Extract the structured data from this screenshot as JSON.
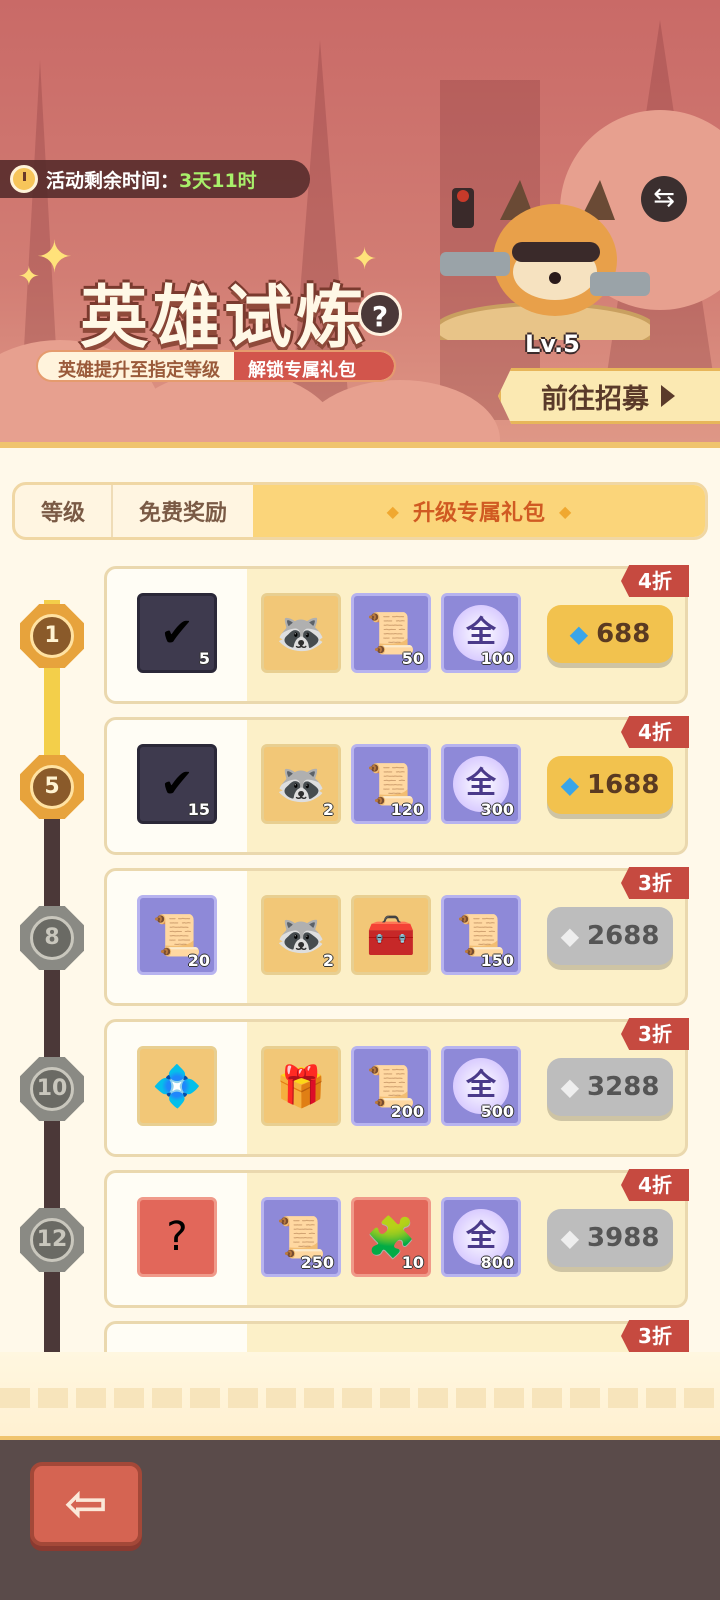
{
  "header": {
    "timer_label": "活动剩余时间：",
    "timer_value": "3天11时",
    "title": "英雄试炼",
    "help_symbol": "?",
    "sub_left": "英雄提升至指定等级",
    "sub_right": "解锁专属礼包",
    "hero_level": "Lv.5",
    "recruit_label": "前往招募"
  },
  "tabs": [
    {
      "label": "等级"
    },
    {
      "label": "免费奖励"
    },
    {
      "label": "升级专属礼包",
      "active": true
    }
  ],
  "rows": [
    {
      "level": "1",
      "unlocked": true,
      "discount": "4折",
      "price": "688",
      "price_style": "gold",
      "items": [
        {
          "icon": "checklist-icon",
          "qty": "5",
          "bg": "dark"
        },
        {
          "icon": "raccoon-hero-icon",
          "qty": "",
          "bg": "orange"
        },
        {
          "icon": "integral-scroll-icon",
          "qty": "50",
          "bg": "purple"
        },
        {
          "icon": "all-orb-icon",
          "glyph": "全",
          "qty": "100",
          "bg": "purple"
        }
      ]
    },
    {
      "level": "5",
      "unlocked": true,
      "discount": "4折",
      "price": "1688",
      "price_style": "gold",
      "items": [
        {
          "icon": "checklist-icon",
          "qty": "15",
          "bg": "dark"
        },
        {
          "icon": "raccoon-hero-icon",
          "qty": "2",
          "bg": "orange"
        },
        {
          "icon": "integral-scroll-icon",
          "qty": "120",
          "bg": "purple"
        },
        {
          "icon": "all-orb-icon",
          "glyph": "全",
          "qty": "300",
          "bg": "purple"
        }
      ]
    },
    {
      "level": "8",
      "unlocked": false,
      "discount": "3折",
      "price": "2688",
      "price_style": "grey",
      "items": [
        {
          "icon": "integral-scroll-icon",
          "qty": "20",
          "bg": "purple"
        },
        {
          "icon": "raccoon-hero-icon",
          "qty": "2",
          "bg": "orange"
        },
        {
          "icon": "treasure-chest-icon",
          "qty": "",
          "bg": "orange"
        },
        {
          "icon": "integral-scroll-icon",
          "qty": "150",
          "bg": "purple"
        }
      ]
    },
    {
      "level": "10",
      "unlocked": false,
      "discount": "3折",
      "price": "3288",
      "price_style": "grey",
      "items": [
        {
          "icon": "crystal-pack-icon",
          "qty": "",
          "bg": "orange"
        },
        {
          "icon": "magic-box-icon",
          "qty": "",
          "bg": "orange"
        },
        {
          "icon": "integral-scroll-icon",
          "qty": "200",
          "bg": "purple"
        },
        {
          "icon": "all-orb-icon",
          "glyph": "全",
          "qty": "500",
          "bg": "purple"
        }
      ]
    },
    {
      "level": "12",
      "unlocked": false,
      "discount": "4折",
      "price": "3988",
      "price_style": "grey",
      "items": [
        {
          "icon": "mystery-card-icon",
          "qty": "",
          "bg": "red"
        },
        {
          "icon": "integral-scroll-icon",
          "qty": "250",
          "bg": "purple"
        },
        {
          "icon": "puzzle-piece-icon",
          "qty": "10",
          "bg": "red"
        },
        {
          "icon": "all-orb-icon",
          "glyph": "全",
          "qty": "800",
          "bg": "purple"
        }
      ]
    }
  ],
  "partial_row": {
    "discount": "3折"
  },
  "footer": {
    "back_symbol": "⇦"
  }
}
